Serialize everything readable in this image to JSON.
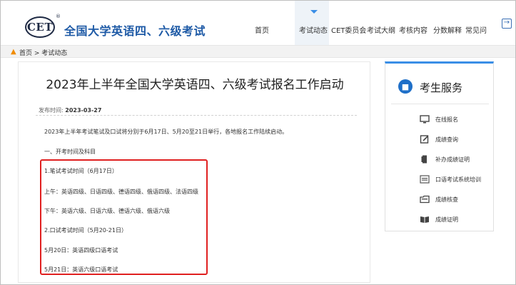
{
  "header": {
    "logo_text": "CET",
    "logo_reg": "®",
    "site_title": "全国大学英语四、六级考试",
    "nav": [
      {
        "label": "首页"
      },
      {
        "label": "考试动态"
      },
      {
        "label": "CET委员会"
      },
      {
        "label": "考试大纲"
      },
      {
        "label": "考核内容"
      },
      {
        "label": "分数解释"
      },
      {
        "label": "常见问"
      }
    ],
    "active_nav": "考试动态"
  },
  "breadcrumb": {
    "text": "首页 > 考试动态"
  },
  "article": {
    "title": "2023年上半年全国大学英语四、六级考试报名工作启动",
    "pub_label": "发布时间:",
    "pub_date": "2023-03-27",
    "paragraphs": [
      "2023年上半年考试笔试及口试将分别于6月17日、5月20至21日举行，各地报名工作陆续启动。",
      "一、开考时间及科目",
      "1.笔试考试时间（6月17日）",
      "上午：英语四级、日语四级、德语四级、俄语四级、法语四级",
      "下午：英语六级、日语六级、德语六级、俄语六级",
      "2.口试考试时间（5月20-21日）",
      "5月20日：英语四级口语考试",
      "5月21日：英语六级口语考试"
    ]
  },
  "sidebar": {
    "title": "考生服务",
    "items": [
      {
        "label": "在线报名",
        "icon": "monitor-icon"
      },
      {
        "label": "成绩查询",
        "icon": "edit-icon"
      },
      {
        "label": "补办成绩证明",
        "icon": "document-icon"
      },
      {
        "label": "口语考试系统培训",
        "icon": "screen-icon"
      },
      {
        "label": "成绩核查",
        "icon": "folder-icon"
      },
      {
        "label": "成绩证明",
        "icon": "book-icon"
      }
    ]
  },
  "colors": {
    "brand_blue": "#1e5aa6",
    "accent_blue": "#3a8ee6",
    "highlight_red": "#e02020",
    "home_orange": "#f08c00"
  }
}
